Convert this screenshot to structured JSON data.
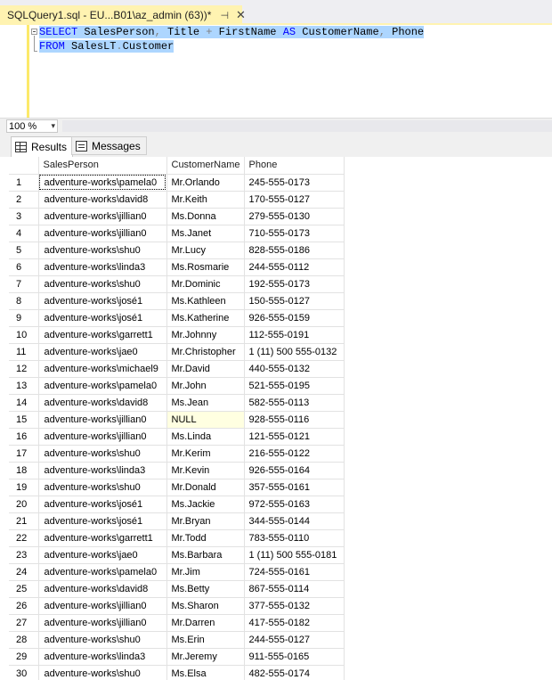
{
  "tab": {
    "title": "SQLQuery1.sql - EU...B01\\az_admin (63))*",
    "pin": "⊣",
    "close": "✕"
  },
  "editor": {
    "line1": {
      "kw1": "SELECT",
      "col1": " SalesPerson",
      "comma1": ",",
      "col2": " Title ",
      "plus": "+",
      "col3": " FirstName ",
      "kw2": "AS",
      "alias": " CustomerName",
      "comma2": ",",
      "col4": " Phone"
    },
    "line2": {
      "kw": "FROM",
      "table": " SalesLT",
      "dot": ".",
      "name": "Customer"
    }
  },
  "zoom": {
    "value": "100 %"
  },
  "results_tabs": {
    "results": "Results",
    "messages": "Messages"
  },
  "grid": {
    "columns": [
      "",
      "SalesPerson",
      "CustomerName",
      "Phone"
    ],
    "rows": [
      [
        "1",
        "adventure-works\\pamela0",
        "Mr.Orlando",
        "245-555-0173"
      ],
      [
        "2",
        "adventure-works\\david8",
        "Mr.Keith",
        "170-555-0127"
      ],
      [
        "3",
        "adventure-works\\jillian0",
        "Ms.Donna",
        "279-555-0130"
      ],
      [
        "4",
        "adventure-works\\jillian0",
        "Ms.Janet",
        "710-555-0173"
      ],
      [
        "5",
        "adventure-works\\shu0",
        "Mr.Lucy",
        "828-555-0186"
      ],
      [
        "6",
        "adventure-works\\linda3",
        "Ms.Rosmarie",
        "244-555-0112"
      ],
      [
        "7",
        "adventure-works\\shu0",
        "Mr.Dominic",
        "192-555-0173"
      ],
      [
        "8",
        "adventure-works\\josé1",
        "Ms.Kathleen",
        "150-555-0127"
      ],
      [
        "9",
        "adventure-works\\josé1",
        "Ms.Katherine",
        "926-555-0159"
      ],
      [
        "10",
        "adventure-works\\garrett1",
        "Mr.Johnny",
        "112-555-0191"
      ],
      [
        "11",
        "adventure-works\\jae0",
        "Mr.Christopher",
        "1 (11) 500 555-0132"
      ],
      [
        "12",
        "adventure-works\\michael9",
        "Mr.David",
        "440-555-0132"
      ],
      [
        "13",
        "adventure-works\\pamela0",
        "Mr.John",
        "521-555-0195"
      ],
      [
        "14",
        "adventure-works\\david8",
        "Ms.Jean",
        "582-555-0113"
      ],
      [
        "15",
        "adventure-works\\jillian0",
        "NULL",
        "928-555-0116"
      ],
      [
        "16",
        "adventure-works\\jillian0",
        "Ms.Linda",
        "121-555-0121"
      ],
      [
        "17",
        "adventure-works\\shu0",
        "Mr.Kerim",
        "216-555-0122"
      ],
      [
        "18",
        "adventure-works\\linda3",
        "Mr.Kevin",
        "926-555-0164"
      ],
      [
        "19",
        "adventure-works\\shu0",
        "Mr.Donald",
        "357-555-0161"
      ],
      [
        "20",
        "adventure-works\\josé1",
        "Ms.Jackie",
        "972-555-0163"
      ],
      [
        "21",
        "adventure-works\\josé1",
        "Mr.Bryan",
        "344-555-0144"
      ],
      [
        "22",
        "adventure-works\\garrett1",
        "Mr.Todd",
        "783-555-0110"
      ],
      [
        "23",
        "adventure-works\\jae0",
        "Ms.Barbara",
        "1 (11) 500 555-0181"
      ],
      [
        "24",
        "adventure-works\\pamela0",
        "Mr.Jim",
        "724-555-0161"
      ],
      [
        "25",
        "adventure-works\\david8",
        "Ms.Betty",
        "867-555-0114"
      ],
      [
        "26",
        "adventure-works\\jillian0",
        "Ms.Sharon",
        "377-555-0132"
      ],
      [
        "27",
        "adventure-works\\jillian0",
        "Mr.Darren",
        "417-555-0182"
      ],
      [
        "28",
        "adventure-works\\shu0",
        "Ms.Erin",
        "244-555-0127"
      ],
      [
        "29",
        "adventure-works\\linda3",
        "Mr.Jeremy",
        "911-555-0165"
      ],
      [
        "30",
        "adventure-works\\shu0",
        "Ms.Elsa",
        "482-555-0174"
      ]
    ],
    "null_value": "NULL"
  }
}
